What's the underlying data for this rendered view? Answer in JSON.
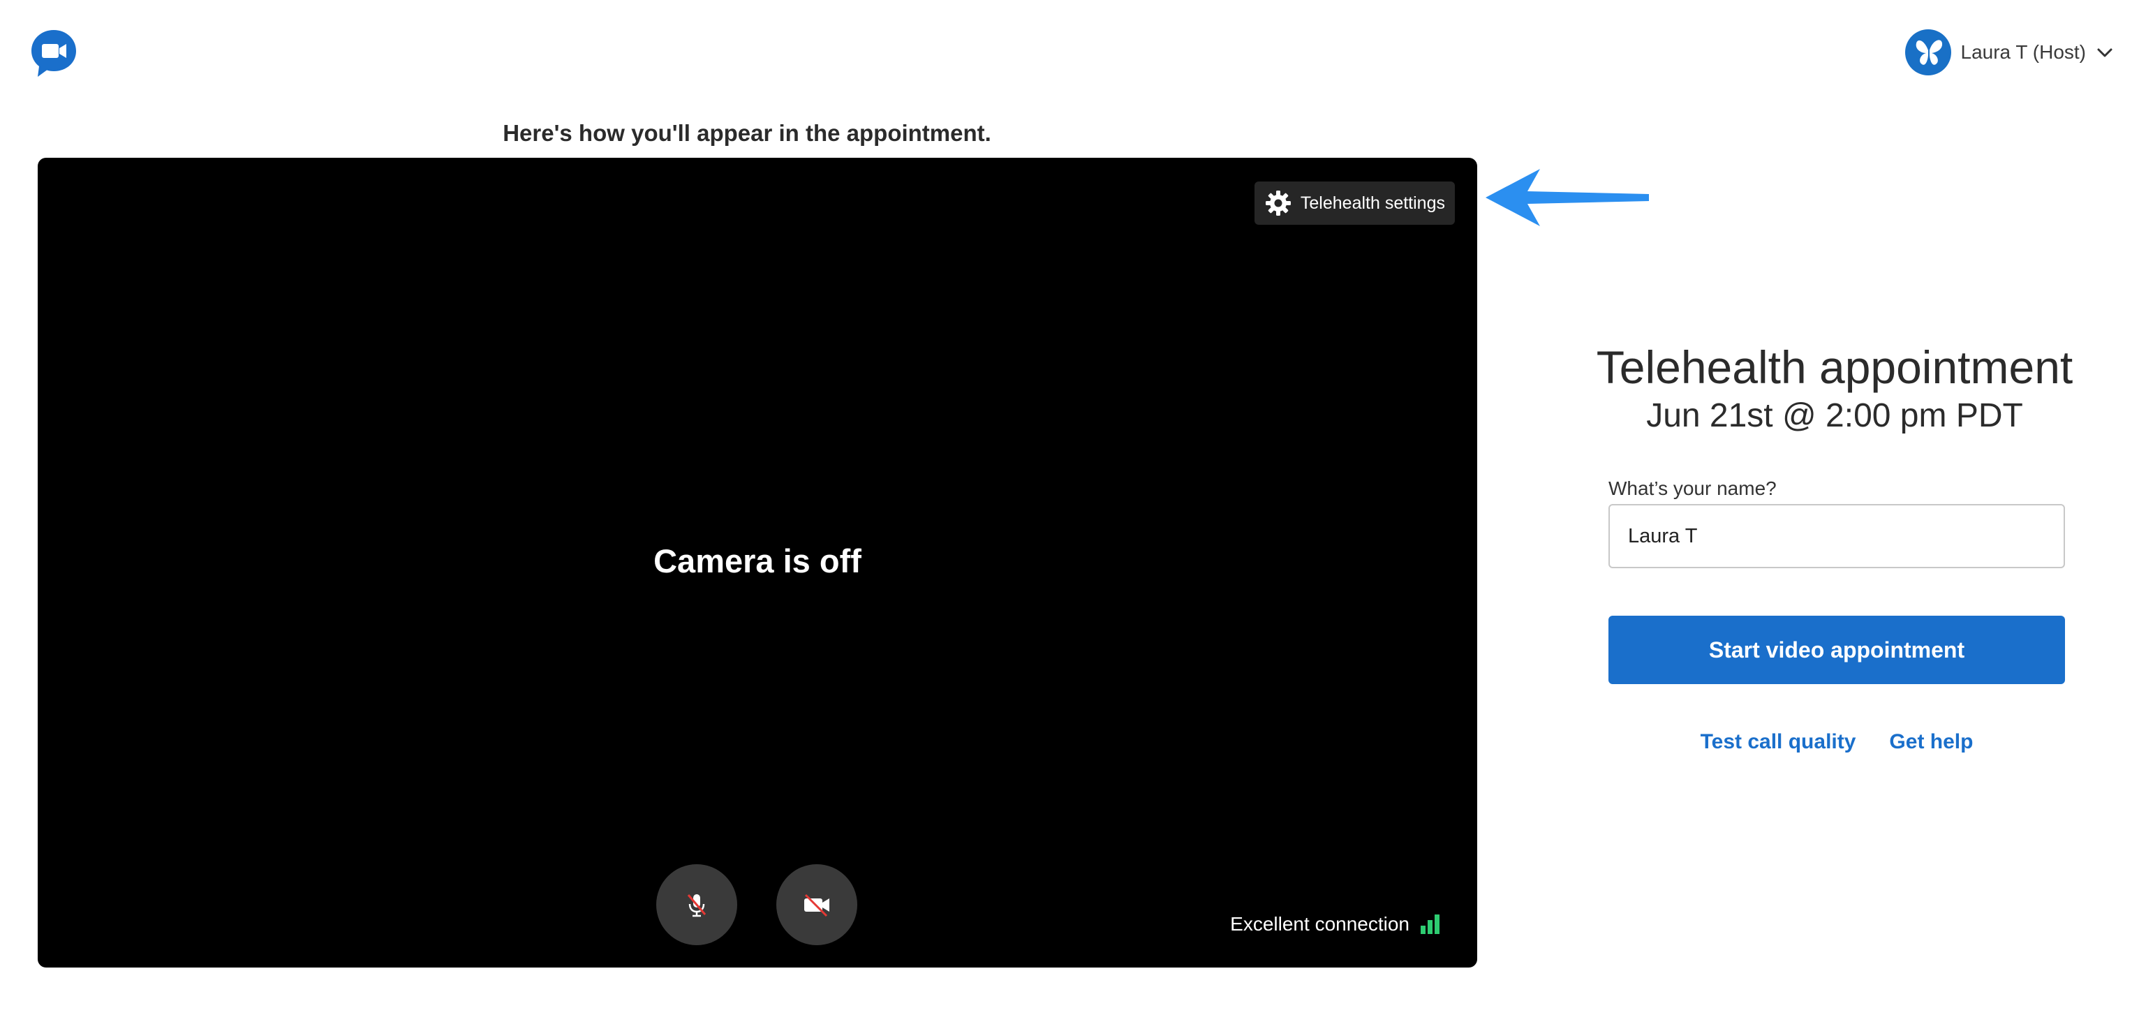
{
  "header": {
    "logo_icon": "video-chat-bubble-icon",
    "user_label": "Laura T (Host)",
    "avatar_icon": "butterfly-icon",
    "menu_icon": "chevron-down-icon"
  },
  "preview": {
    "heading": "Here's how you'll appear in the appointment.",
    "settings_label": "Telehealth settings",
    "settings_icon": "gear-icon",
    "camera_status": "Camera is off",
    "mic_icon": "microphone-muted-icon",
    "camera_icon": "camera-off-icon",
    "connection_label": "Excellent connection",
    "connection_icon": "signal-bars-icon"
  },
  "appointment": {
    "title": "Telehealth appointment",
    "datetime": "Jun 21st @ 2:00 pm PDT",
    "name_label": "What’s your name?",
    "name_value": "Laura T",
    "start_button": "Start video appointment",
    "link_test": "Test call quality",
    "link_help": "Get help"
  },
  "colors": {
    "brand_blue": "#1a6fcb",
    "signal_green": "#2ecc71",
    "annotation_arrow": "#2b8ff0"
  }
}
